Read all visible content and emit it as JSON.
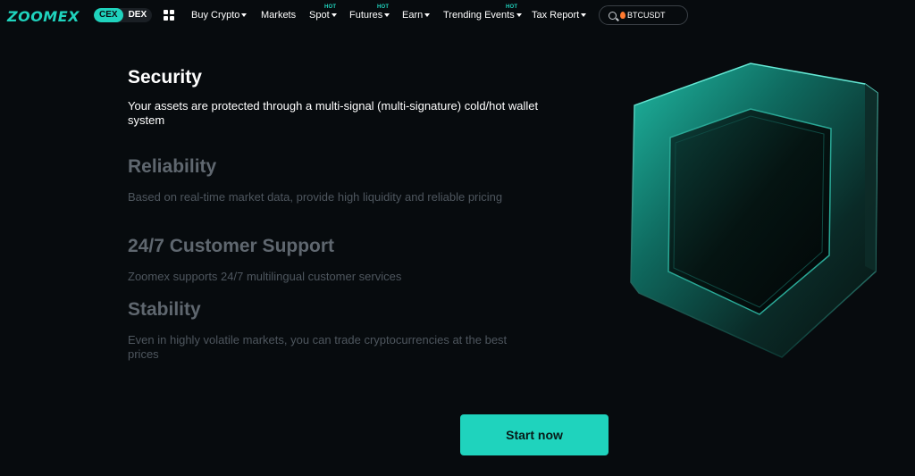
{
  "header": {
    "logo": "ZOOMEX",
    "modes": [
      "CEX",
      "DEX"
    ],
    "active_mode": "CEX",
    "nav": [
      {
        "label": "Buy Crypto",
        "dropdown": true,
        "hot": false
      },
      {
        "label": "Markets",
        "dropdown": false,
        "hot": false
      },
      {
        "label": "Spot",
        "dropdown": true,
        "hot": true
      },
      {
        "label": "Futures",
        "dropdown": true,
        "hot": true
      },
      {
        "label": "Earn",
        "dropdown": true,
        "hot": false
      },
      {
        "label": "Trending Events",
        "dropdown": true,
        "hot": true
      },
      {
        "label": "Tax Report",
        "dropdown": true,
        "hot": false
      }
    ],
    "hot_label": "HOT",
    "search": {
      "value": "BTCUSDT",
      "icon": "search-icon",
      "badge_icon": "fire-icon"
    }
  },
  "features": [
    {
      "title": "Security",
      "description": "Your assets are protected through a multi-signal (multi-signature) cold/hot wallet system",
      "active": true
    },
    {
      "title": "Reliability",
      "description": "Based on real-time market data, provide high liquidity and reliable pricing",
      "active": false
    },
    {
      "title": "24/7 Customer Support",
      "description": "Zoomex supports 24/7 multilingual customer services",
      "active": false
    },
    {
      "title": "Stability",
      "description": "Even in highly volatile markets, you can trade cryptocurrencies at the best prices",
      "active": false
    }
  ],
  "cta": {
    "label": "Start now"
  },
  "colors": {
    "accent": "#1fd3bd",
    "background": "#070b0e",
    "dim_text": "#5f676f"
  }
}
